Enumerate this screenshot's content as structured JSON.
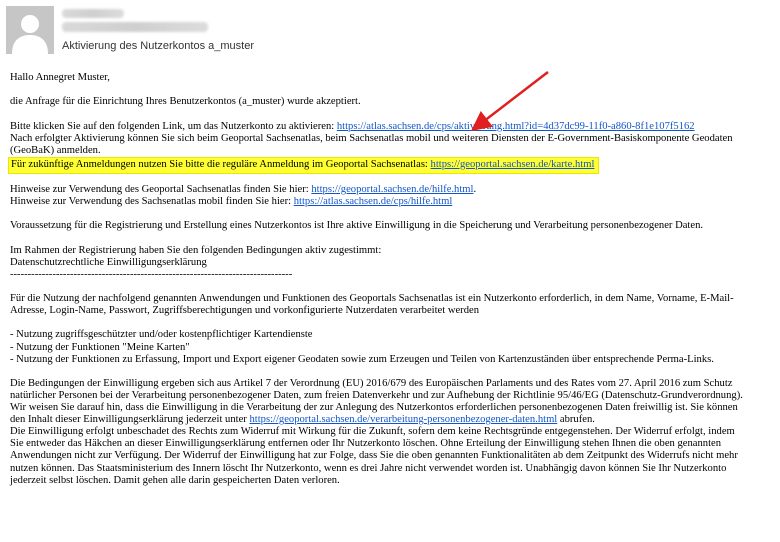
{
  "header": {
    "subject": "Aktivierung des Nutzerkontos a_muster"
  },
  "email": {
    "greeting": "Hallo Annegret Muster,",
    "accepted": "die Anfrage für die Einrichtung Ihres Benutzerkontos (a_muster) wurde akzeptiert.",
    "activate_prefix": "Bitte klicken Sie auf den folgenden Link, um das Nutzerkonto zu aktivieren: ",
    "activate_link": "https://atlas.sachsen.de/cps/aktivierung.html?id=4d37dc99-11f0-a860-8f1e107f5162",
    "after_activation_1": "Nach erfolgter Aktivierung können Sie sich beim Geoportal Sachsenatlas, beim Sachsenatlas mobil und weiteren Diensten der E-Government-Basiskomponente Geodaten",
    "after_activation_2": "(GeoBaK) anmelden.",
    "future_login_prefix": "Für zukünftige Anmeldungen nutzen Sie bitte die reguläre Anmeldung im Geoportal Sachsenatlas: ",
    "future_login_link": "https://geoportal.sachsen.de/karte.html",
    "hint_geoportal_prefix": "Hinweise zur Verwendung des Geoportal Sachsenatlas finden Sie hier: ",
    "hint_geoportal_link": "https://geoportal.sachsen.de/hilfe.html",
    "hint_geoportal_suffix": ".",
    "hint_mobil_prefix": "Hinweise zur Verwendung des Sachsenatlas mobil finden Sie hier: ",
    "hint_mobil_link": "https://atlas.sachsen.de/cps/hilfe.html",
    "prerequisite": "Voraussetzung für die Registrierung und Erstellung eines Nutzerkontos ist Ihre aktive Einwilligung in die Speicherung und Verarbeitung personenbezogener Daten.",
    "conditions_intro": "Im Rahmen der Registrierung haben Sie den folgenden Bedingungen aktiv zugestimmt:",
    "consent_title": "Datenschutzrechtliche Einwilligungserklärung",
    "separator": "--------------------------------------------------------------------------------",
    "usage_1": "Für die Nutzung der nachfolgend genannten Anwendungen und Funktionen des Geoportals Sachsenatlas ist ein Nutzerkonto erforderlich, in dem Name, Vorname, E-Mail-",
    "usage_2": "Adresse, Login-Name, Passwort, Zugriffsberechtigungen und vorkonfigurierte Nutzerdaten verarbeitet werden",
    "list_1": "- Nutzung zugriffsgeschützter und/oder kostenpflichtiger Kartendienste",
    "list_2": "- Nutzung der Funktionen \"Meine Karten\"",
    "list_3": "- Nutzung der Funktionen zu Erfassung, Import und Export eigener Geodaten sowie zum Erzeugen und Teilen von Kartenzuständen über entsprechende Perma-Links.",
    "legal_1": "Die Bedingungen der Einwilligung ergeben sich aus Artikel 7 der Verordnung (EU) 2016/679 des Europäischen Parlaments und des Rates vom 27. April 2016 zum Schutz",
    "legal_2": "natürlicher Personen bei der Verarbeitung personenbezogener Daten, zum freien Datenverkehr und zur Aufhebung der Richtlinie 95/46/EG (Datenschutz-Grundverordnung).",
    "legal_3": "Wir weisen Sie darauf hin, dass die Einwilligung in die Verarbeitung der zur Anlegung des Nutzerkontos erforderlichen personenbezogenen Daten freiwillig ist. Sie können",
    "legal_4_prefix": "den Inhalt dieser Einwilligungserklärung jederzeit unter ",
    "legal_4_link": "https://geoportal.sachsen.de/verarbeitung-personenbezogener-daten.html",
    "legal_4_suffix": " abrufen.",
    "revoke_1": "Die Einwilligung erfolgt unbeschadet des Rechts zum Widerruf mit Wirkung für die Zukunft, sofern dem keine Rechtsgründe entgegenstehen. Der Widerruf erfolgt, indem",
    "revoke_2": "Sie entweder das Häkchen an dieser Einwilligungserklärung entfernen oder Ihr Nutzerkonto löschen. Ohne Erteilung der Einwilligung stehen Ihnen die oben genannten",
    "revoke_3": "Anwendungen nicht zur Verfügung. Der Widerruf der Einwilligung hat zur Folge, dass Sie die oben genannten Funktionalitäten ab dem Zeitpunkt des Widerrufs nicht mehr",
    "revoke_4": "nutzen können. Das Staatsministerium des Innern löscht Ihr Nutzerkonto, wenn es drei Jahre nicht verwendet worden ist. Unabhängig davon können Sie Ihr Nutzerkonto",
    "revoke_5": "jederzeit selbst löschen. Damit gehen alle darin gespeicherten Daten verloren."
  },
  "colors": {
    "link": "#1155cc",
    "highlight": "#ffff33",
    "arrow": "#e02020"
  },
  "icons": {
    "avatar": "person-silhouette-icon",
    "arrow": "red-arrow-annotation"
  }
}
